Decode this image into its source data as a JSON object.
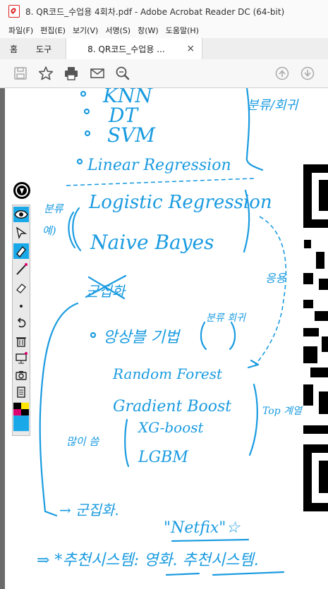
{
  "window": {
    "title": "8. QR코드_수업용 4회차.pdf - Adobe Acrobat Reader DC (64-bit)"
  },
  "menu": [
    "파일(F)",
    "편집(E)",
    "보기(V)",
    "서명(S)",
    "창(W)",
    "도움말(H)"
  ],
  "tabs": {
    "home": "홈",
    "tools": "도구",
    "document": "8. QR코드_수업용 ...",
    "close": "×"
  },
  "toolbar": [
    "save-icon",
    "bookmark-star-icon",
    "print-icon",
    "email-icon",
    "zoom-search-icon",
    "page-up-icon",
    "page-down-icon"
  ],
  "palette": [
    "pen-logo-icon",
    "eye-icon",
    "select-arrow-icon",
    "highlighter-icon",
    "pen-icon",
    "eraser-icon",
    "dot-icon",
    "undo-icon",
    "trash-icon",
    "screen-icon",
    "camera-icon",
    "notes-icon",
    "color-swatch-icon"
  ],
  "handwriting": {
    "list_items": [
      "KNN",
      "DT",
      "SVM",
      "Linear Regression"
    ],
    "side_note_top": "분류/회귀",
    "classification_label": "분류",
    "example_label": "예)",
    "classification_items": [
      "Logistic Regression",
      "Naive Bayes"
    ],
    "side_note_mid": "응용",
    "clustering_struck": "군집화",
    "ensemble": "앙상블 기법",
    "ensemble_note": "분류 회귀",
    "ensemble_items": [
      "Random Forest",
      "Gradient Boost",
      "XG-boost",
      "LGBM"
    ],
    "many_used": "많이 씀",
    "top_note": "Top 계열",
    "clustering": "→ 군집화.",
    "netflix": "\"Netfix\"☆",
    "recommend": "⇒ *추천시스템: 영화. 추천시스템."
  },
  "colors": {
    "ink": "#1a9be0",
    "accent_red": "#d22222"
  }
}
